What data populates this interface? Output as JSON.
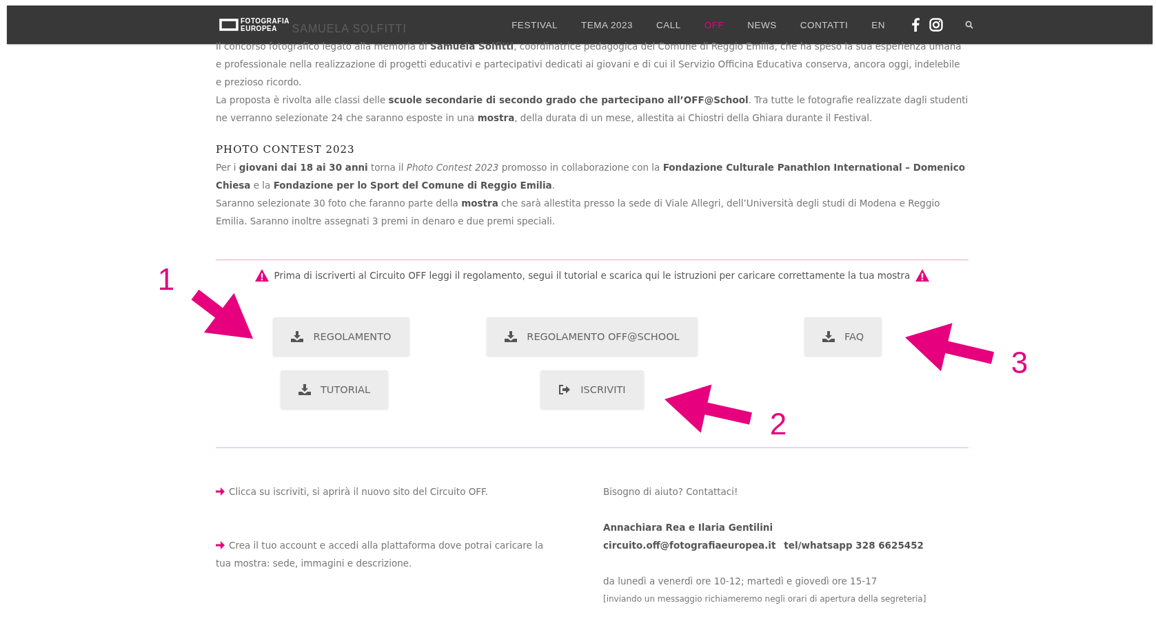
{
  "nav": {
    "logo": "FOTOGRAFIA EUROPEA",
    "items": [
      {
        "label": "FESTIVAL",
        "selected": false
      },
      {
        "label": "TEMA 2023",
        "selected": false
      },
      {
        "label": "CALL",
        "selected": false
      },
      {
        "label": "OFF",
        "selected": true
      },
      {
        "label": "NEWS",
        "selected": false
      },
      {
        "label": "CONTATTI",
        "selected": false
      },
      {
        "label": "EN",
        "selected": false
      }
    ]
  },
  "heading": "SAMUELA SOLFITTI",
  "intro": [
    "Il concorso fotografico legato alla memoria di **Samuela Solfitti**, coordinatrice pedagogica del Comune di Reggio Emilia, che ha speso la sua esperienza umana e professionale nella realizzazione di progetti educativi e partecipativi dedicati ai giovani e di cui il Servizio Officina Educativa conserva, ancora oggi, indelebile e prezioso ricordo.",
    "La proposta è rivolta alle classi delle **scuole secondarie di secondo grado che partecipano all’OFF@School**. Tra tutte le fotografie realizzate dagli studenti ne verranno selezionate 24 che saranno esposte in una **mostra**, della durata di un mese, allestita ai Chiostri della Ghiara durante il Festival."
  ],
  "contest": {
    "title": "PHOTO CONTEST 2023",
    "paragraphs": [
      "Per i **giovani dai 18 ai 30 anni** torna il *Photo Contest 2023* promosso in collaborazione con la **Fondazione Culturale Panathlon International – Domenico Chiesa**  e la **Fondazione per lo Sport del Comune di Reggio Emilia**.",
      "Saranno selezionate 30 foto che faranno parte della **mostra** che sarà allestita presso la sede di Viale Allegri, dell’Università degli studi di Modena e Reggio Emilia. Saranno inoltre assegnati 3 premi in denaro e due premi speciali."
    ]
  },
  "warning": "Prima di iscriverti al Circuito OFF leggi il regolamento, segui il tutorial e scarica qui le istruzioni per caricare correttamente la tua mostra",
  "buttons": [
    {
      "label": "REGOLAMENTO",
      "kind": "download"
    },
    {
      "label": "REGOLAMENTO OFF@SCHOOL",
      "kind": "download"
    },
    {
      "label": "FAQ",
      "kind": "download"
    },
    {
      "label": "TUTORIAL",
      "kind": "download"
    },
    {
      "label": "ISCRIVITI",
      "kind": "signin"
    }
  ],
  "steps": [
    "Clicca su iscriviti, si aprirà il nuovo sito del Circuito OFF.",
    "Crea il tuo account e accedi alla plattaforma dove potrai caricare la tua mostra: sede, immagini e descrizione."
  ],
  "help": {
    "title": "Bisogno di aiuto? Contattaci!",
    "names": "Annachiara Rea e Ilaria Gentilini",
    "email": "circuito.off@fotografiaeuropea.it",
    "phone": "tel/whatsapp 328 6625452",
    "hours": "da lunedì a venerdì ore 10-12; martedì e giovedì ore 15-17",
    "note": "[inviando un messaggio richiameremo negli orari di apertura della segreteria]"
  },
  "annotations": [
    "1",
    "2",
    "3"
  ]
}
